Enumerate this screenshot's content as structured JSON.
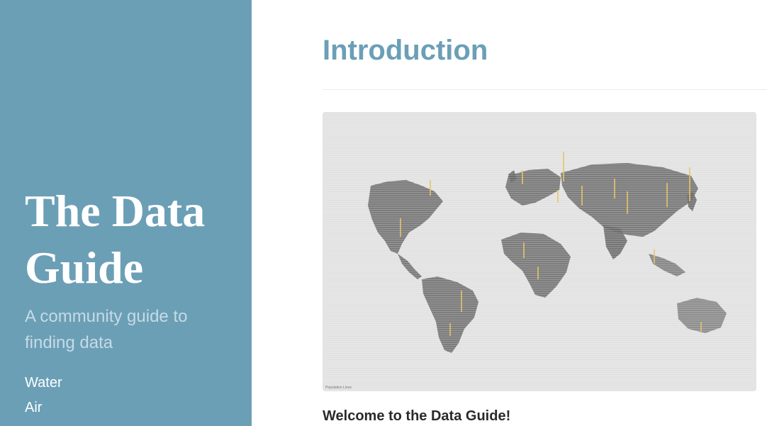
{
  "colors": {
    "sidebar_bg": "#6b9fb6",
    "accent": "#6b9fb6",
    "spike": "#e6c46a"
  },
  "sidebar": {
    "title": "The Data Guide",
    "tagline": "A community guide to finding data",
    "nav": [
      {
        "label": "Water"
      },
      {
        "label": "Air"
      }
    ]
  },
  "main": {
    "title": "Introduction",
    "figure": {
      "caption": "Population Lines"
    },
    "intro_heading": "Welcome to the Data Guide!"
  }
}
